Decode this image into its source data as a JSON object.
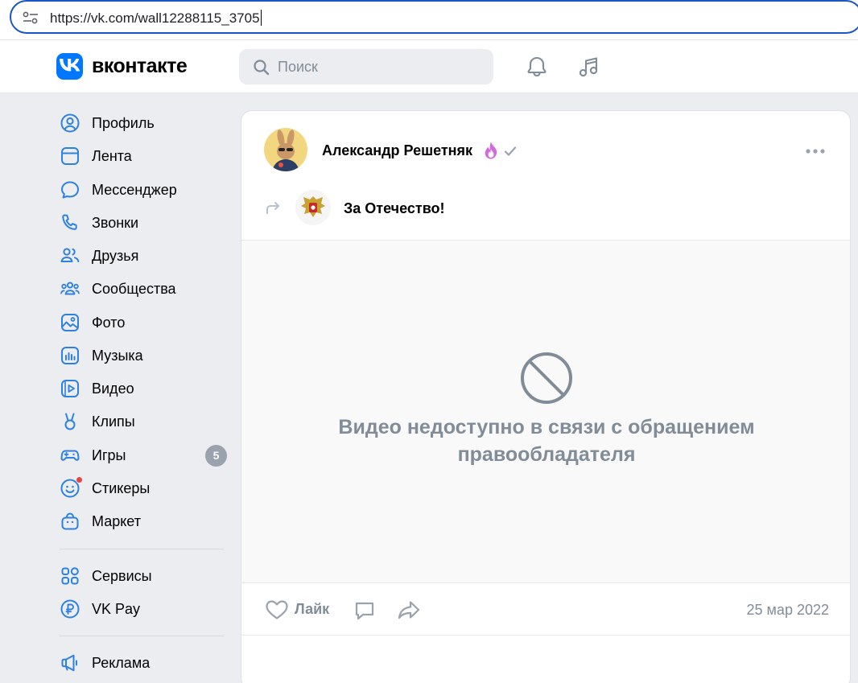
{
  "browser": {
    "url": "https://vk.com/wall12288115_3705"
  },
  "header": {
    "logo_text": "вконтакте",
    "search_placeholder": "Поиск",
    "brand_color": "#0077ff"
  },
  "leftnav": {
    "items": [
      {
        "label": "Профиль",
        "icon": "user-circle-icon"
      },
      {
        "label": "Лента",
        "icon": "newsfeed-icon"
      },
      {
        "label": "Мессенджер",
        "icon": "message-icon"
      },
      {
        "label": "Звонки",
        "icon": "phone-icon"
      },
      {
        "label": "Друзья",
        "icon": "friends-icon"
      },
      {
        "label": "Сообщества",
        "icon": "communities-icon"
      },
      {
        "label": "Фото",
        "icon": "photo-icon"
      },
      {
        "label": "Музыка",
        "icon": "music-icon"
      },
      {
        "label": "Видео",
        "icon": "video-icon"
      },
      {
        "label": "Клипы",
        "icon": "clips-icon"
      },
      {
        "label": "Игры",
        "icon": "gamepad-icon",
        "badge": "5"
      },
      {
        "label": "Стикеры",
        "icon": "sticker-icon"
      },
      {
        "label": "Маркет",
        "icon": "market-bag-icon"
      }
    ],
    "secondary": [
      {
        "label": "Сервисы",
        "icon": "services-grid-icon"
      },
      {
        "label": "VK Pay",
        "icon": "vkpay-ruble-icon"
      }
    ],
    "tertiary": [
      {
        "label": "Реклама",
        "icon": "megaphone-icon"
      }
    ]
  },
  "post": {
    "author": "Александр Решетняк",
    "author_badge_icon": "fire-icon",
    "verified_icon": "checkmark-icon",
    "repost_group": "За Отечество!",
    "video_unavailable_text": "Видео недоступно в связи с обращением правообладателя",
    "like_label": "Лайк",
    "date": "25 мар 2022",
    "muted_color": "#818c99"
  }
}
